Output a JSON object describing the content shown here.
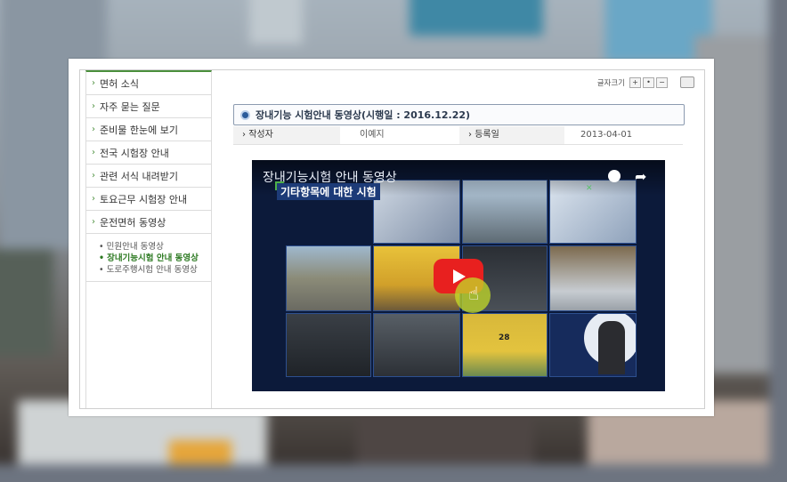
{
  "sidebar": {
    "items": [
      {
        "label": "면허 소식"
      },
      {
        "label": "자주 묻는 질문"
      },
      {
        "label": "준비물 한눈에 보기"
      },
      {
        "label": "전국 시험장 안내"
      },
      {
        "label": "관련 서식 내려받기"
      },
      {
        "label": "토요근무 시험장 안내"
      },
      {
        "label": "운전면허 동영상"
      }
    ],
    "subitems": [
      {
        "label": "민원안내 동영상"
      },
      {
        "label": "장내기능시험 안내 동영상"
      },
      {
        "label": "도로주행시험 안내 동영상"
      }
    ]
  },
  "toolbar": {
    "font_size_label": "글자크기",
    "plus": "+",
    "mid": "•",
    "minus": "−"
  },
  "article": {
    "title": "장내기능 시험안내 동영상(시행일 : 2016.12.22)",
    "author_label": "작성자",
    "author_value": "이예지",
    "date_label": "등록일",
    "date_value": "2013-04-01"
  },
  "video": {
    "title": "장내기능시험 안내 동영상",
    "subtitle": "기타항목에 대한 시험",
    "taxi_number": "28"
  },
  "colors": {
    "accent_green": "#4a8f3c",
    "play_red": "#e8201f"
  }
}
